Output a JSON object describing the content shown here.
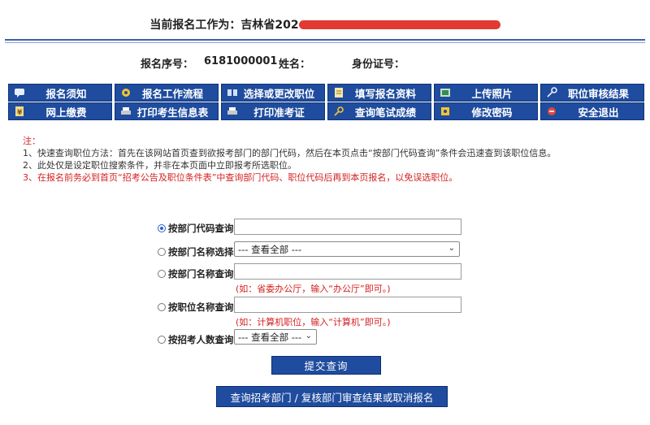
{
  "header": {
    "title_prefix": "当前报名工作为：吉林省202",
    "redacted_title": "(redacted)"
  },
  "applicant": {
    "serial_label": "报名序号：",
    "serial_value": "6181000001",
    "name_label": "姓名：",
    "id_label": "身份证号："
  },
  "nav": [
    {
      "label": "报名须知",
      "icon": "notice-icon"
    },
    {
      "label": "报名工作流程",
      "icon": "flow-icon"
    },
    {
      "label": "选择或更改职位",
      "icon": "position-icon"
    },
    {
      "label": "填写报名资料",
      "icon": "form-icon"
    },
    {
      "label": "上传照片",
      "icon": "photo-icon"
    },
    {
      "label": "职位审核结果",
      "icon": "key-icon"
    },
    {
      "label": "网上缴费",
      "icon": "payment-icon"
    },
    {
      "label": "打印考生信息表",
      "icon": "printer-icon"
    },
    {
      "label": "打印准考证",
      "icon": "printer-icon"
    },
    {
      "label": "查询笔试成绩",
      "icon": "search-icon"
    },
    {
      "label": "修改密码",
      "icon": "password-icon"
    },
    {
      "label": "安全退出",
      "icon": "exit-icon"
    }
  ],
  "notes": {
    "heading": "注：",
    "line1": "1、快速查询职位方法：首先在该网站首页查到欲报考部门的部门代码，然后在本页点击“按部门代码查询”条件会迅速查到该职位信息。",
    "line2": "2、此处仅是设定职位搜索条件，并非在本页面中立即报考所选职位。",
    "line3": "3、在报名前务必到首页“招考公告及职位条件表”中查询部门代码、职位代码后再到本页报名，以免误选职位。"
  },
  "search": {
    "by_dept_code": "按部门代码查询",
    "by_dept_select": "按部门名称选择",
    "dept_select_value": "--- 查看全部 ---",
    "by_dept_name": "按部门名称查询",
    "dept_name_hint": "(如：省委办公厅，输入“办公厅”即可。)",
    "by_position_name": "按职位名称查询",
    "position_name_hint": "(如：计算机职位，输入“计算机”即可。)",
    "by_headcount": "按招考人数查询",
    "headcount_value": "--- 查看全部 ---",
    "selected": "by_dept_code"
  },
  "buttons": {
    "submit": "提交查询",
    "query_dept": "查询招考部门 / 复核部门审查结果或取消报名"
  },
  "colors": {
    "nav_bg": "#1f4c9e",
    "note_red": "#d42020",
    "redaction": "#e03a32"
  }
}
